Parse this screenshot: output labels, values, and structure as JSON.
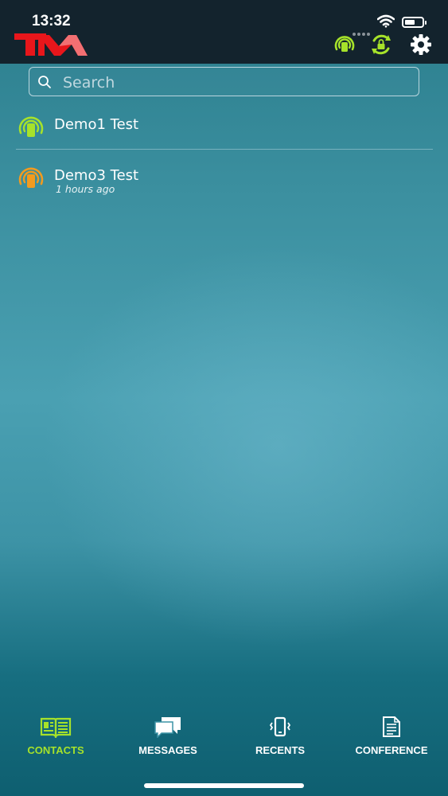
{
  "status_bar": {
    "time": "13:32"
  },
  "header": {
    "logo": "tm-logo",
    "icons": [
      "radio-signal-icon",
      "lock-refresh-icon",
      "gear-icon"
    ]
  },
  "search": {
    "placeholder": "Search",
    "value": ""
  },
  "contacts": [
    {
      "name": "Demo1 Test",
      "subtitle": "",
      "status_color": "#a6e22a"
    },
    {
      "name": "Demo3 Test",
      "subtitle": "1 hours ago",
      "status_color": "#f29b1f"
    }
  ],
  "tabs": [
    {
      "label": "CONTACTS",
      "icon": "contacts-book-icon",
      "active": true
    },
    {
      "label": "MESSAGES",
      "icon": "messages-icon",
      "active": false
    },
    {
      "label": "RECENTS",
      "icon": "phone-vibrate-icon",
      "active": false
    },
    {
      "label": "CONFERENCE",
      "icon": "document-icon",
      "active": false
    }
  ],
  "colors": {
    "accent": "#a6e22a",
    "topbar": "#13232d",
    "away": "#f29b1f"
  }
}
